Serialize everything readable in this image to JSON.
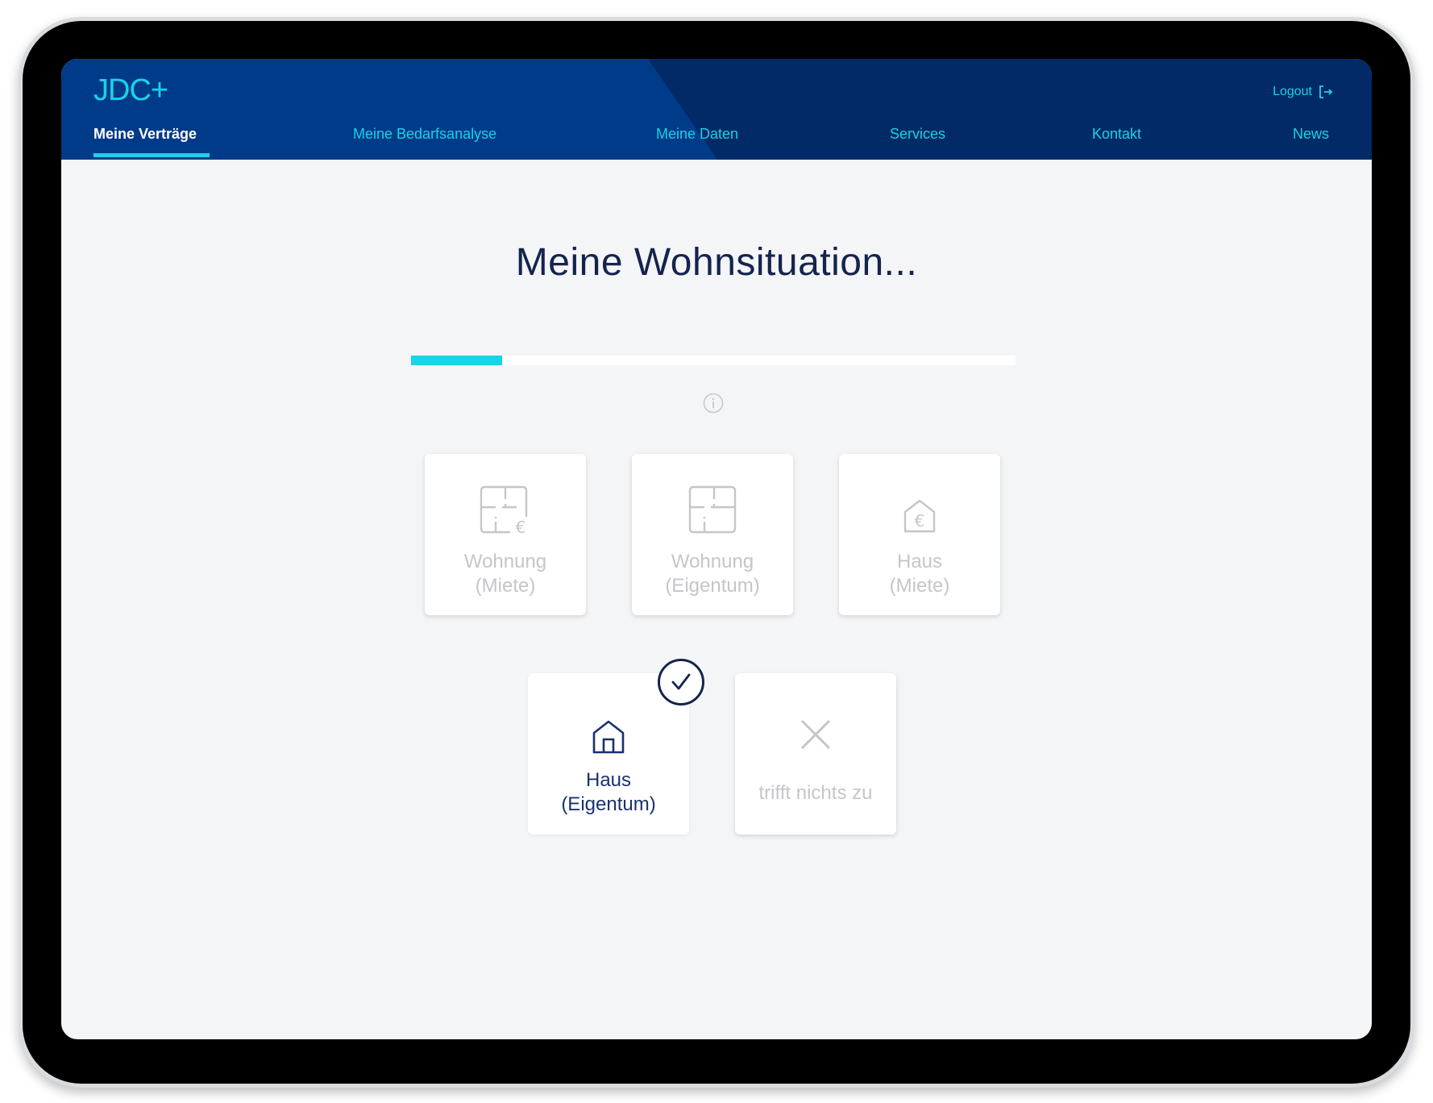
{
  "app": {
    "logo": "JDC+",
    "logout_label": "Logout"
  },
  "nav": [
    {
      "label": "Meine Verträge",
      "active": true
    },
    {
      "label": "Meine Bedarfsanalyse",
      "active": false
    },
    {
      "label": "Meine Daten",
      "active": false
    },
    {
      "label": "Services",
      "active": false
    },
    {
      "label": "Kontakt",
      "active": false
    },
    {
      "label": "News",
      "active": false
    }
  ],
  "page": {
    "title": "Meine Wohnsituation...",
    "progress_fraction": 0.15
  },
  "options": [
    {
      "line1": "Wohnung",
      "line2": "(Miete)",
      "icon": "floorplan-euro-icon",
      "selected": false
    },
    {
      "line1": "Wohnung",
      "line2": "(Eigentum)",
      "icon": "floorplan-icon",
      "selected": false
    },
    {
      "line1": "Haus",
      "line2": "(Miete)",
      "icon": "house-euro-icon",
      "selected": false
    },
    {
      "line1": "Haus",
      "line2": "(Eigentum)",
      "icon": "house-icon",
      "selected": true
    },
    {
      "line1": "trifft nichts zu",
      "icon": "close-icon",
      "selected": false
    }
  ],
  "colors": {
    "header": "#003b8a",
    "accent": "#19d3e6",
    "title": "#14244d",
    "selected_text": "#1a3170",
    "unselected_text": "#c4c6c9"
  }
}
